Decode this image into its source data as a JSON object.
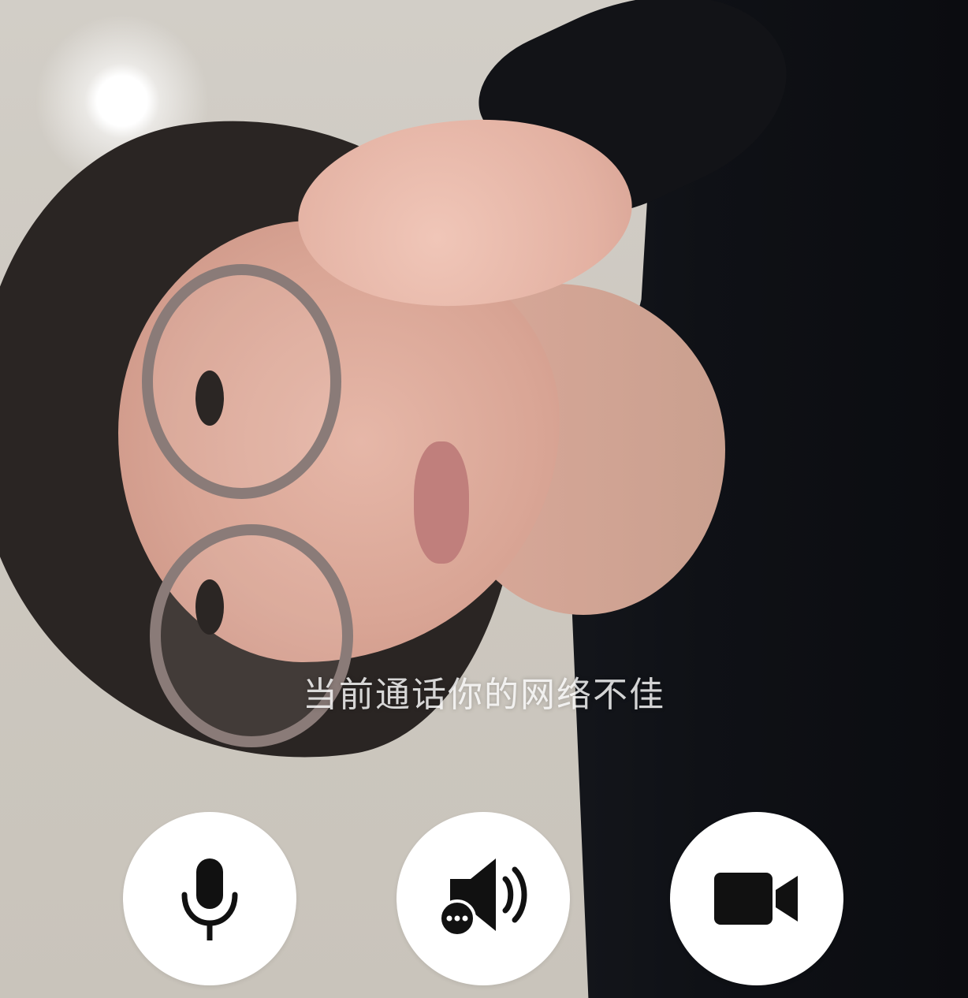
{
  "call": {
    "network_warning": "当前通话你的网络不佳"
  },
  "controls": {
    "mic": {
      "icon": "microphone-icon"
    },
    "speaker": {
      "icon": "speaker-more-icon"
    },
    "camera": {
      "icon": "video-camera-icon"
    }
  },
  "colors": {
    "button_bg": "#ffffff",
    "icon": "#111111",
    "warning_text": "#ffffff"
  }
}
